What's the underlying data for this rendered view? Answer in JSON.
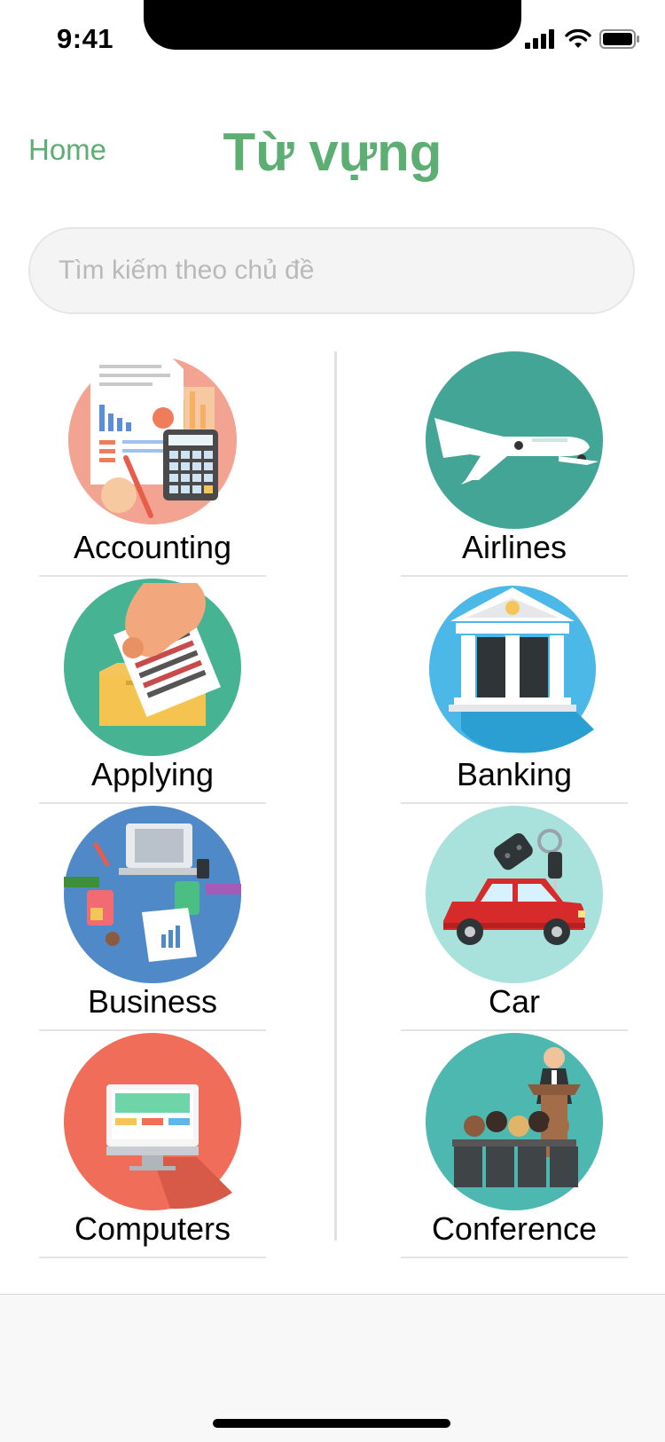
{
  "status": {
    "time": "9:41"
  },
  "header": {
    "home_label": "Home",
    "title": "Từ vựng"
  },
  "search": {
    "placeholder": "Tìm kiếm theo chủ đề",
    "value": ""
  },
  "topics": [
    {
      "label": "Accounting",
      "icon": "accounting-icon",
      "color": "#f2a392"
    },
    {
      "label": "Airlines",
      "icon": "airplane-icon",
      "color": "#43a596"
    },
    {
      "label": "Applying",
      "icon": "application-icon",
      "color": "#46b392"
    },
    {
      "label": "Banking",
      "icon": "bank-icon",
      "color": "#4bb8e8"
    },
    {
      "label": "Business",
      "icon": "business-meeting-icon",
      "color": "#4f89c8"
    },
    {
      "label": "Car",
      "icon": "car-icon",
      "color": "#a9e2dc"
    },
    {
      "label": "Computers",
      "icon": "computer-icon",
      "color": "#ef6d59"
    },
    {
      "label": "Conference",
      "icon": "conference-icon",
      "color": "#4db8b0"
    }
  ]
}
